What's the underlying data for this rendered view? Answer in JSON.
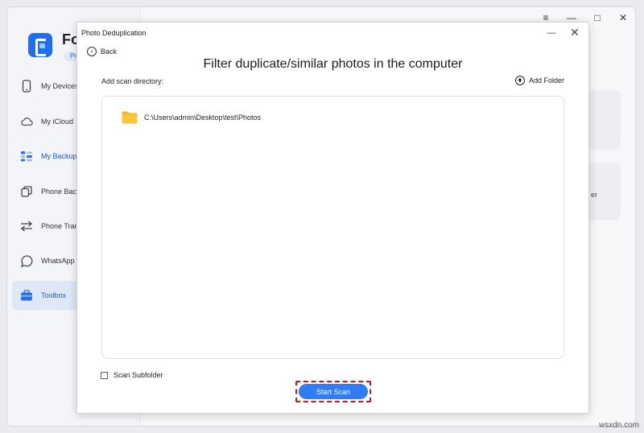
{
  "app": {
    "brand": "Fo",
    "badge": "Pr",
    "window_controls": [
      "≡",
      "—",
      "□",
      "✕"
    ],
    "sidebar": {
      "items": [
        {
          "label": "My Devices",
          "icon": "phone-icon"
        },
        {
          "label": "My iCloud",
          "icon": "cloud-icon"
        },
        {
          "label": "My Backups",
          "icon": "backups-icon"
        },
        {
          "label": "Phone Back",
          "icon": "copy-icon"
        },
        {
          "label": "Phone Trans",
          "icon": "transfer-icon"
        },
        {
          "label": "WhatsApp M",
          "icon": "whatsapp-icon"
        },
        {
          "label": "Toolbox",
          "icon": "toolbox-icon"
        }
      ]
    },
    "background_card_text": "er"
  },
  "dialog": {
    "title": "Photo Deduplication",
    "minimize": "—",
    "close": "✕",
    "back_label": "Back",
    "heading": "Filter duplicate/similar photos in the computer",
    "scan_directory_label": "Add scan directory:",
    "add_folder_label": "Add Folder",
    "directories": [
      "C:\\Users\\admin\\Desktop\\test\\Photos"
    ],
    "scan_subfolder_label": "Scan Subfolder",
    "scan_subfolder_checked": false,
    "start_scan_label": "Start Scan"
  },
  "colors": {
    "accent": "#2f7cf6",
    "highlight_border": "#c0171b",
    "folder": "#f6b924"
  },
  "watermark": "wsxdn.com"
}
